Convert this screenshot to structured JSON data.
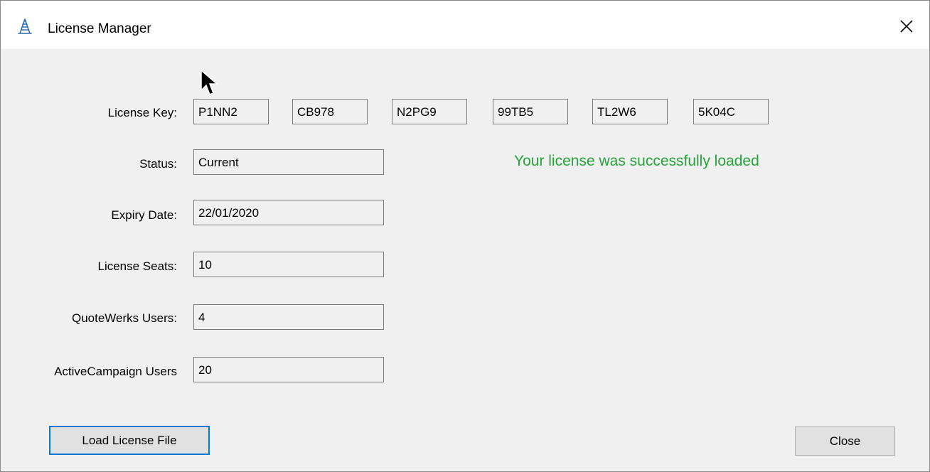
{
  "window": {
    "title": "License Manager",
    "app_icon": "tower-icon",
    "close_icon": "close-icon"
  },
  "license_key": {
    "label": "License Key:",
    "segments": [
      "P1NN2",
      "CB978",
      "N2PG9",
      "99TB5",
      "TL2W6",
      "5K04C"
    ]
  },
  "fields": {
    "status": {
      "label": "Status:",
      "value": "Current"
    },
    "expiry": {
      "label": "Expiry Date:",
      "value": "22/01/2020"
    },
    "seats": {
      "label": "License Seats:",
      "value": "10"
    },
    "quotewerks": {
      "label": "QuoteWerks Users:",
      "value": "4"
    },
    "activecampaign": {
      "label": "ActiveCampaign Users",
      "value": "20"
    }
  },
  "message": {
    "text": "Your license was successfully loaded",
    "color": "#26a33a"
  },
  "buttons": {
    "load_label": "Load License File",
    "close_label": "Close"
  },
  "colors": {
    "focus_border": "#0078d7",
    "background": "#f0f0f0"
  }
}
